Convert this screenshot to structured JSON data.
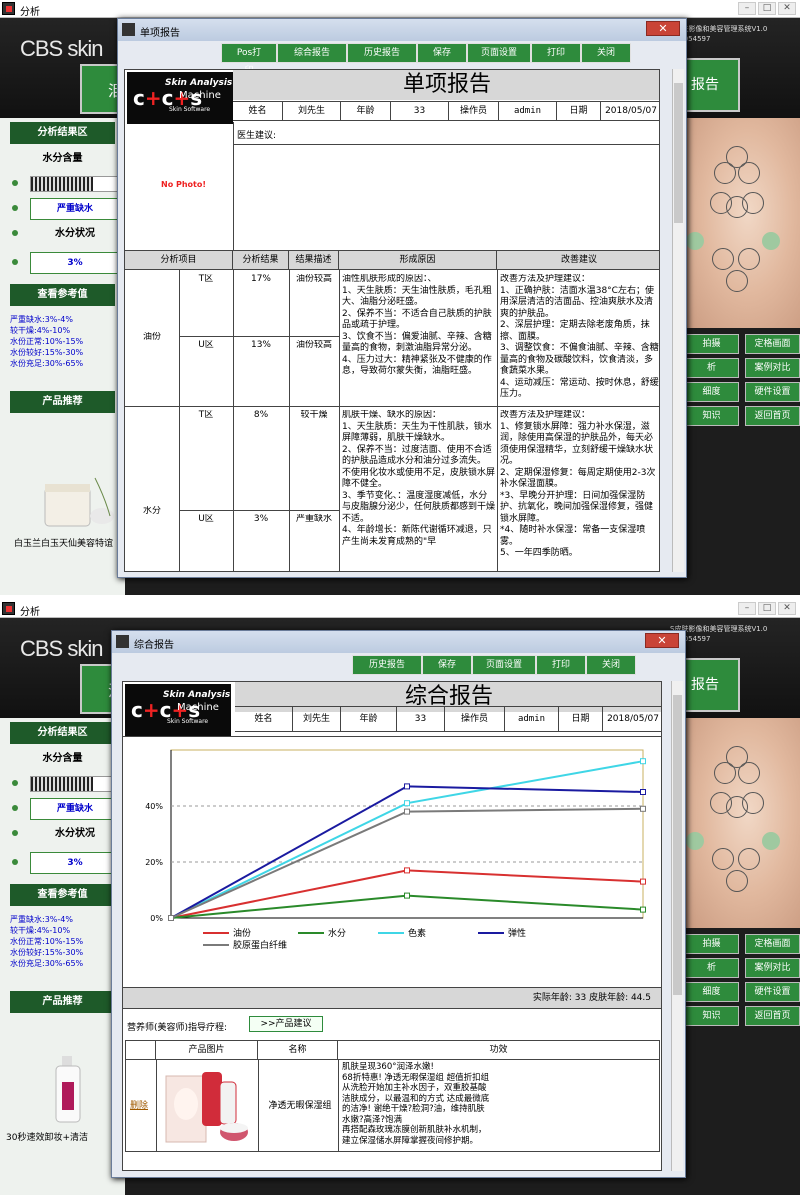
{
  "app": {
    "window_title": "分析",
    "logo_text": "CBS skin",
    "sys_title": "S皮肤影像和美容管理系统V1.0",
    "serial": "ESR054597",
    "report_btn": "报告"
  },
  "left": {
    "section1": "分析结果区",
    "moisture_title": "水分含量",
    "moisture_value": "严重缺水",
    "status_title": "水分状况",
    "status_value": "3%",
    "ref_title": "查看参考值",
    "refs": [
      "严重缺水:3%-4%",
      "较干燥:4%-10%",
      "水份正常:10%-15%",
      "水份较好:15%-30%",
      "水份充足:30%-65%"
    ],
    "product_title": "产品推荐",
    "product_top": "白玉兰白玉天仙美容特谊",
    "product_bottom": "30秒速效卸妆+清洁"
  },
  "right_buttons": [
    "拍摄",
    "定格画面",
    "析",
    "案例对比",
    "细度",
    "硬件设置",
    "知识",
    "返回首页"
  ],
  "dialog1": {
    "title": "单项报告",
    "buttons": [
      "Pos打印",
      "综合报告",
      "历史报告",
      "保存",
      "页面设置",
      "打印",
      "关闭"
    ],
    "report_title": "单项报告",
    "no_photo": "No Photo!",
    "info": {
      "name_label": "姓名",
      "name": "刘先生",
      "age_label": "年龄",
      "age": "33",
      "operator_label": "操作员",
      "operator": "admin",
      "date_label": "日期",
      "date": "2018/05/07"
    },
    "advice_label": "医生建议:",
    "headers": [
      "分析项目",
      "分析结果",
      "结果描述",
      "形成原因",
      "改善建议"
    ],
    "rows": [
      {
        "item": "油份",
        "zone1": "T区",
        "res1": "17%",
        "desc1": "油份较高",
        "zone2": "U区",
        "res2": "13%",
        "desc2": "油份较高",
        "cause": "油性肌肤形成的原因：、\n1、天生肤质：天生油性肤质，毛孔粗大、油脂分泌旺盛。\n2、保养不当：不适合自己肤质的护肤品或疏于护理。\n3、饮食不当：偏爱油腻、辛辣、含糖量高的食物，刺激油脂异常分泌。\n4、压力过大：精神紧张及不健康的作息，导致荷尔蒙失衡，油脂旺盛。",
        "advice": "改善方法及护理建议：\n1、正确护肤：洁面水温38°C左右；使用深层清洁的洁面品、控油爽肤水及清爽的护肤品。\n2、深层护理：定期去除老废角质，抹擦、面膜。\n3、调整饮食：不偏食油腻、辛辣、含糖量高的食物及碳酸饮料，饮食清淡，多食蔬菜水果。\n4、运动减压：常运动、按时休息，舒缓压力。"
      },
      {
        "item": "水分",
        "zone1": "T区",
        "res1": "8%",
        "desc1": "较干燥",
        "zone2": "U区",
        "res2": "3%",
        "desc2": "严重缺水",
        "cause": "肌肤干燥、缺水的原因：\n1、天生肤质：天生为干性肌肤，锁水屏障薄弱，肌肤干燥缺水。\n2、保养不当：过度洁面、使用不合适的护肤品造成水分和油分过多流失。\n不使用化妆水或使用不足，皮肤锁水屏障不健全。\n3、季节变化、：温度湿度减低，水分与皮脂腺分泌少，任何肤质都感到干燥不适。\n4、年龄增长：新陈代谢循环减退，只产生尚未发育成熟的\"早",
        "advice": "改善方法及护理建议：\n1、修复锁水屏障：强力补水保湿，滋润，除使用高保湿的护肤品外，每天必须使用保湿精华，立刻舒缓干燥缺水状况。\n2、定期保湿修复：每周定期使用2-3次补水保湿面膜。\n*3、早晚分开护理：日间加强保湿防护、抗氧化，晚间加强保湿修复，强健锁水屏障。\n*4、随时补水保湿：常备一支保湿喷雾。\n5、一年四季防晒。"
      }
    ]
  },
  "dialog2": {
    "title": "综合报告",
    "buttons": [
      "历史报告",
      "保存",
      "页面设置",
      "打印",
      "关闭"
    ],
    "report_title": "综合报告",
    "info": {
      "name_label": "姓名",
      "name": "刘先生",
      "age_label": "年龄",
      "age": "33",
      "operator_label": "操作员",
      "operator": "admin",
      "date_label": "日期",
      "date": "2018/05/07"
    },
    "age_line": "实际年龄: 33  皮肤年龄: 44.5",
    "guide_label": "营养师(美容师)指导疗程:",
    "guide_btn": ">>产品建议",
    "prod_headers": [
      "产品图片",
      "名称",
      "功效"
    ],
    "product": {
      "delete": "删除",
      "name": "净透无暇保湿组",
      "effect": "肌肤呈现360°润泽水嫩!\n68折特惠! 净透无暇保湿组 超值折扣组\n从洗脸开始加主补水因子，双重胶基酸\n洁肤成分，以最温和的方式 达成最微底\n的洁净! 谢绝干燥?脸洞?油，维持肌肤\n水嫩?高泽?饱满\n再搭配森玫瑰冻膜创新肌肤补水机制，\n建立保湿储水屏障掌握夜间修护期。"
    }
  },
  "chart_data": {
    "type": "line",
    "x": [
      0,
      1,
      2
    ],
    "ylim": [
      0,
      0.6
    ],
    "yticks": [
      "0%",
      "20%",
      "40%"
    ],
    "series": [
      {
        "name": "油份",
        "color": "#d83030",
        "values": [
          0,
          0.17,
          0.13
        ]
      },
      {
        "name": "水分",
        "color": "#2a8a2a",
        "values": [
          0,
          0.08,
          0.03
        ]
      },
      {
        "name": "色素",
        "color": "#3fd6e6",
        "values": [
          0,
          0.41,
          0.56
        ]
      },
      {
        "name": "弹性",
        "color": "#1a1aa0",
        "values": [
          0,
          0.47,
          0.45
        ]
      },
      {
        "name": "胶原蛋白纤维",
        "color": "#7a7a7a",
        "values": [
          0,
          0.38,
          0.39
        ]
      }
    ]
  }
}
